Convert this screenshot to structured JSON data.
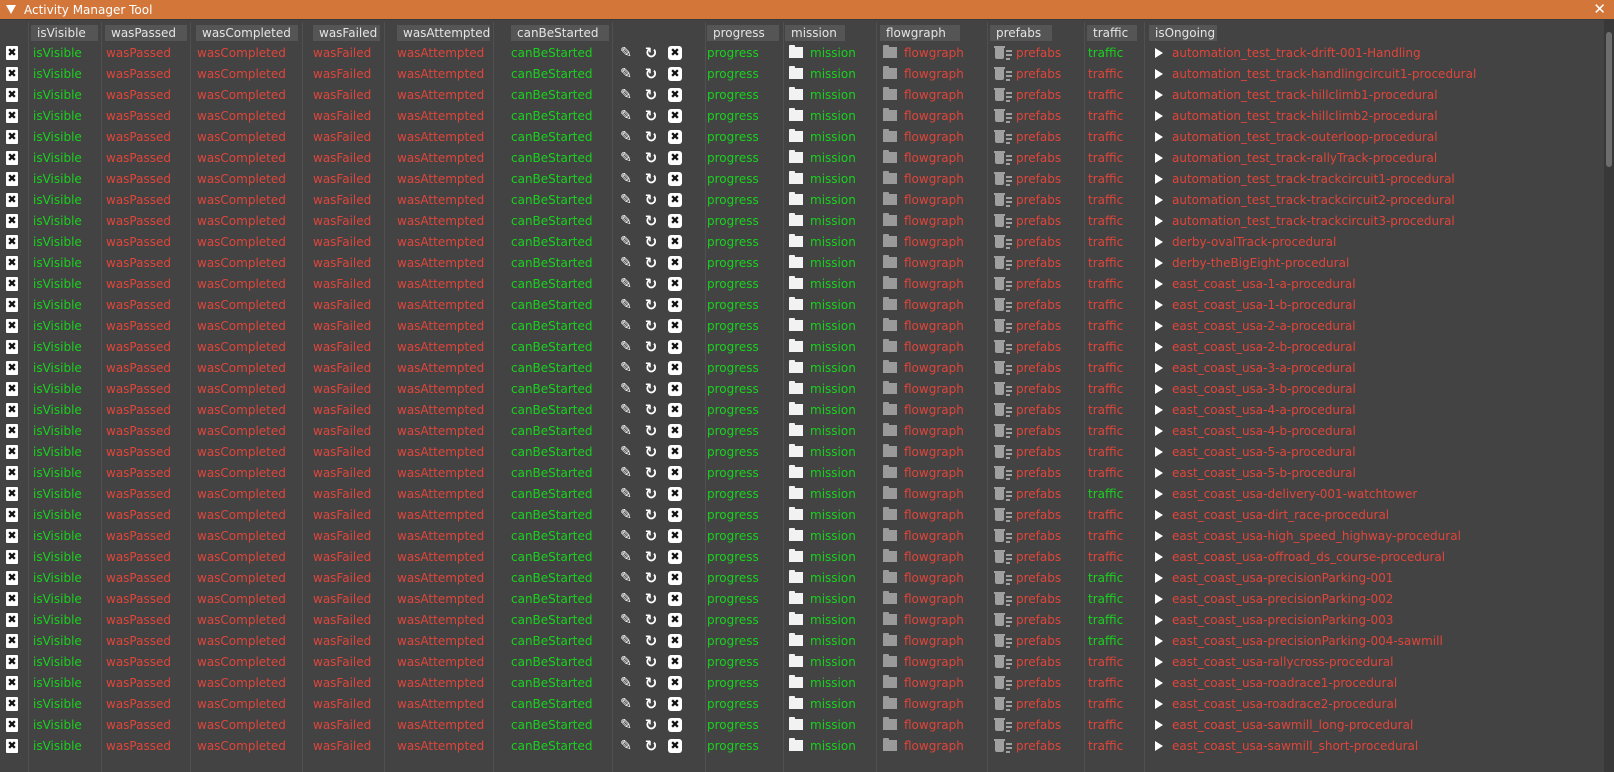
{
  "window": {
    "title": "Activity Manager Tool",
    "close_glyph": "✕"
  },
  "headers": [
    "isVisible",
    "wasPassed",
    "wasCompleted",
    "wasFailed",
    "wasAttempted",
    "canBeStarted",
    "progress",
    "mission",
    "flowgraph",
    "prefabs",
    "traffic",
    "isOngoing"
  ],
  "icons": {
    "delete": "trash-box-icon",
    "edit": "pencil-icon",
    "reload": "refresh-icon",
    "remove": "close-box-icon",
    "mission": "folder-icon",
    "flowgraph": "folder-icon",
    "prefabs": "trash-list-icon",
    "start": "play-icon"
  },
  "colors": {
    "true": "#19d21e",
    "false": "#e0453a",
    "titlebar": "#d2763a"
  },
  "cell_text": {
    "isVisible": "isVisible",
    "wasPassed": "wasPassed",
    "wasCompleted": "wasCompleted",
    "wasFailed": "wasFailed",
    "wasAttempted": "wasAttempted",
    "canBeStarted": "canBeStarted",
    "progress": "progress",
    "mission": "mission",
    "flowgraph": "flowgraph",
    "prefabs": "prefabs",
    "traffic": "traffic"
  },
  "rows": [
    {
      "name": "automation_test_track-drift-001-Handling",
      "traffic": true
    },
    {
      "name": "automation_test_track-handlingcircuit1-procedural",
      "traffic": false
    },
    {
      "name": "automation_test_track-hillclimb1-procedural",
      "traffic": false
    },
    {
      "name": "automation_test_track-hillclimb2-procedural",
      "traffic": false
    },
    {
      "name": "automation_test_track-outerloop-procedural",
      "traffic": false
    },
    {
      "name": "automation_test_track-rallyTrack-procedural",
      "traffic": false
    },
    {
      "name": "automation_test_track-trackcircuit1-procedural",
      "traffic": false
    },
    {
      "name": "automation_test_track-trackcircuit2-procedural",
      "traffic": false
    },
    {
      "name": "automation_test_track-trackcircuit3-procedural",
      "traffic": false
    },
    {
      "name": "derby-ovalTrack-procedural",
      "traffic": false
    },
    {
      "name": "derby-theBigEight-procedural",
      "traffic": false
    },
    {
      "name": "east_coast_usa-1-a-procedural",
      "traffic": false
    },
    {
      "name": "east_coast_usa-1-b-procedural",
      "traffic": false
    },
    {
      "name": "east_coast_usa-2-a-procedural",
      "traffic": false
    },
    {
      "name": "east_coast_usa-2-b-procedural",
      "traffic": false
    },
    {
      "name": "east_coast_usa-3-a-procedural",
      "traffic": false
    },
    {
      "name": "east_coast_usa-3-b-procedural",
      "traffic": false
    },
    {
      "name": "east_coast_usa-4-a-procedural",
      "traffic": false
    },
    {
      "name": "east_coast_usa-4-b-procedural",
      "traffic": false
    },
    {
      "name": "east_coast_usa-5-a-procedural",
      "traffic": false
    },
    {
      "name": "east_coast_usa-5-b-procedural",
      "traffic": false
    },
    {
      "name": "east_coast_usa-delivery-001-watchtower",
      "traffic": true
    },
    {
      "name": "east_coast_usa-dirt_race-procedural",
      "traffic": false
    },
    {
      "name": "east_coast_usa-high_speed_highway-procedural",
      "traffic": false
    },
    {
      "name": "east_coast_usa-offroad_ds_course-procedural",
      "traffic": false
    },
    {
      "name": "east_coast_usa-precisionParking-001",
      "traffic": true
    },
    {
      "name": "east_coast_usa-precisionParking-002",
      "traffic": true
    },
    {
      "name": "east_coast_usa-precisionParking-003",
      "traffic": true
    },
    {
      "name": "east_coast_usa-precisionParking-004-sawmill",
      "traffic": true
    },
    {
      "name": "east_coast_usa-rallycross-procedural",
      "traffic": false
    },
    {
      "name": "east_coast_usa-roadrace1-procedural",
      "traffic": false
    },
    {
      "name": "east_coast_usa-roadrace2-procedural",
      "traffic": false
    },
    {
      "name": "east_coast_usa-sawmill_long-procedural",
      "traffic": false
    },
    {
      "name": "east_coast_usa-sawmill_short-procedural",
      "traffic": false
    }
  ]
}
